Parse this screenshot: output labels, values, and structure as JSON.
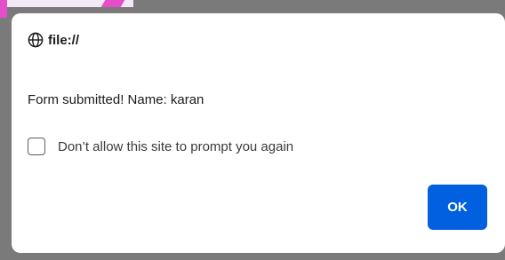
{
  "dialog": {
    "origin": "file://",
    "message": "Form submitted! Name: karan",
    "checkbox_label": "Don’t allow this site to prompt you again",
    "checkbox_checked": false,
    "ok_label": "OK",
    "globe_icon": "globe-icon"
  },
  "colors": {
    "accent": "#0060df",
    "backdrop": "#7a7a7a",
    "dialog_bg": "#ffffff",
    "text": "#1b1b1b"
  }
}
